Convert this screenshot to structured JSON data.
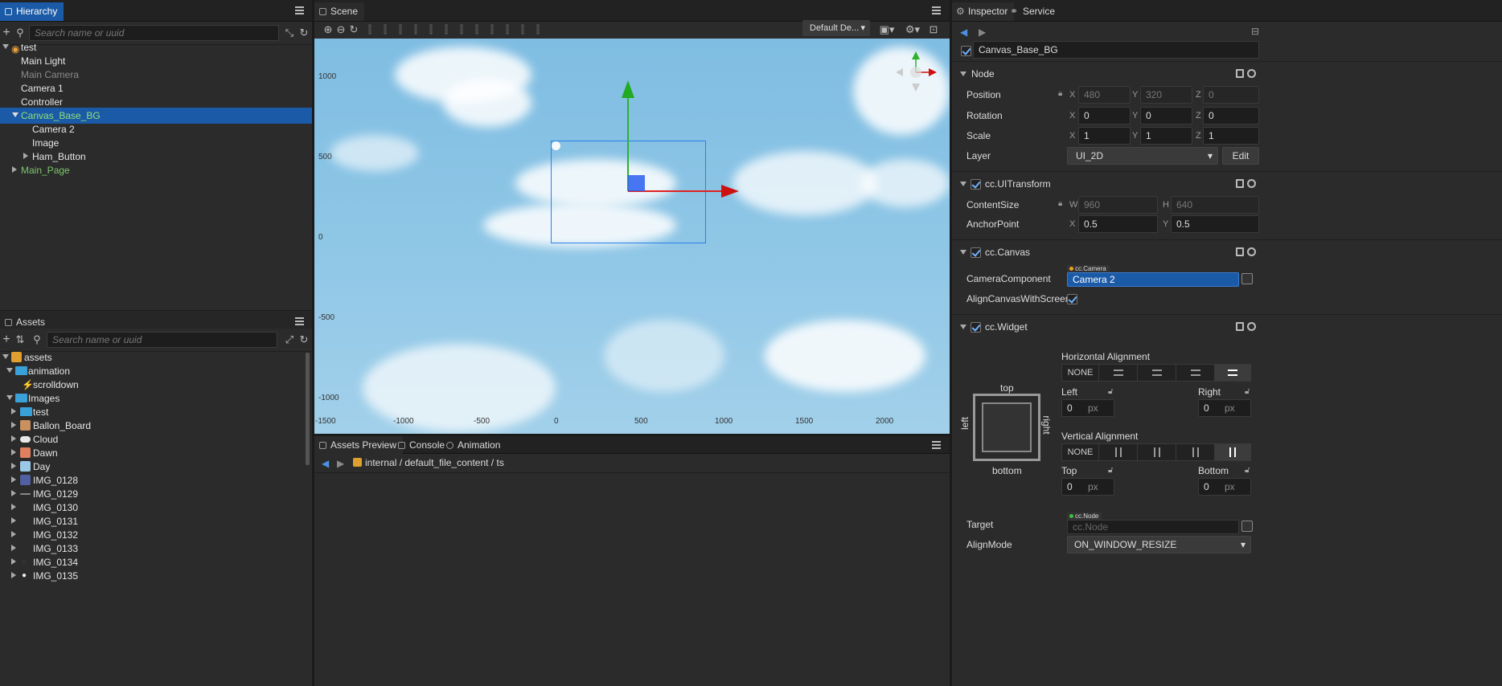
{
  "hierarchy": {
    "tab": "Hierarchy",
    "search_placeholder": "Search name or uuid",
    "items": [
      {
        "label": "test"
      },
      {
        "label": "Main Light"
      },
      {
        "label": "Main Camera"
      },
      {
        "label": "Camera 1"
      },
      {
        "label": "Controller"
      },
      {
        "label": "Canvas_Base_BG"
      },
      {
        "label": "Camera 2"
      },
      {
        "label": "Image"
      },
      {
        "label": "Ham_Button"
      },
      {
        "label": "Main_Page"
      }
    ]
  },
  "assets": {
    "tab": "Assets",
    "search_placeholder": "Search name or uuid",
    "items": [
      {
        "label": "assets"
      },
      {
        "label": "animation"
      },
      {
        "label": "scrolldown"
      },
      {
        "label": "Images"
      },
      {
        "label": "test"
      },
      {
        "label": "Ballon_Board"
      },
      {
        "label": "Cloud"
      },
      {
        "label": "Dawn"
      },
      {
        "label": "Day"
      },
      {
        "label": "IMG_0128"
      },
      {
        "label": "IMG_0129"
      },
      {
        "label": "IMG_0130"
      },
      {
        "label": "IMG_0131"
      },
      {
        "label": "IMG_0132"
      },
      {
        "label": "IMG_0133"
      },
      {
        "label": "IMG_0134"
      },
      {
        "label": "IMG_0135"
      }
    ]
  },
  "scene": {
    "tab": "Scene",
    "dropdown": "Default De...",
    "rulers_y": [
      "1000",
      "500",
      "0",
      "-500",
      "-1000"
    ],
    "rulers_x": [
      "-1500",
      "-1000",
      "-500",
      "0",
      "500",
      "1000",
      "1500",
      "2000"
    ]
  },
  "bottom": {
    "tabs": [
      "Assets Preview",
      "Console",
      "Animation"
    ],
    "path": [
      "internal",
      "default_file_content",
      "ts"
    ]
  },
  "inspector": {
    "tabs": [
      "Inspector",
      "Service"
    ],
    "node_name": "Canvas_Base_BG",
    "node_section": "Node",
    "position": {
      "label": "Position",
      "x": "480",
      "y": "320",
      "z": "0"
    },
    "rotation": {
      "label": "Rotation",
      "x": "0",
      "y": "0",
      "z": "0"
    },
    "scale": {
      "label": "Scale",
      "x": "1",
      "y": "1",
      "z": "1"
    },
    "layer": {
      "label": "Layer",
      "value": "UI_2D",
      "edit": "Edit"
    },
    "uitransform": {
      "title": "cc.UITransform",
      "content_size": {
        "label": "ContentSize",
        "w": "960",
        "h": "640"
      },
      "anchor": {
        "label": "AnchorPoint",
        "x": "0.5",
        "y": "0.5"
      }
    },
    "canvas": {
      "title": "cc.Canvas",
      "camera_label": "CameraComponent",
      "camera_type": "cc.Camera",
      "camera_value": "Camera 2",
      "align_label": "AlignCanvasWithScreen"
    },
    "widget": {
      "title": "cc.Widget",
      "h_align": "Horizontal Alignment",
      "v_align": "Vertical Alignment",
      "none": "NONE",
      "top": "top",
      "bottom": "bottom",
      "left_side": "left",
      "right_side": "right",
      "left": {
        "label": "Left",
        "value": "0",
        "unit": "px"
      },
      "right": {
        "label": "Right",
        "value": "0",
        "unit": "px"
      },
      "top_f": {
        "label": "Top",
        "value": "0",
        "unit": "px"
      },
      "bottom_f": {
        "label": "Bottom",
        "value": "0",
        "unit": "px"
      },
      "target_label": "Target",
      "target_type": "cc.Node",
      "target_placeholder": "cc.Node",
      "align_mode_label": "AlignMode",
      "align_mode": "ON_WINDOW_RESIZE"
    }
  },
  "colors": {
    "accent": "#1b5aa6",
    "panel": "#2b2b2b",
    "sky": "#8ec6e6"
  }
}
